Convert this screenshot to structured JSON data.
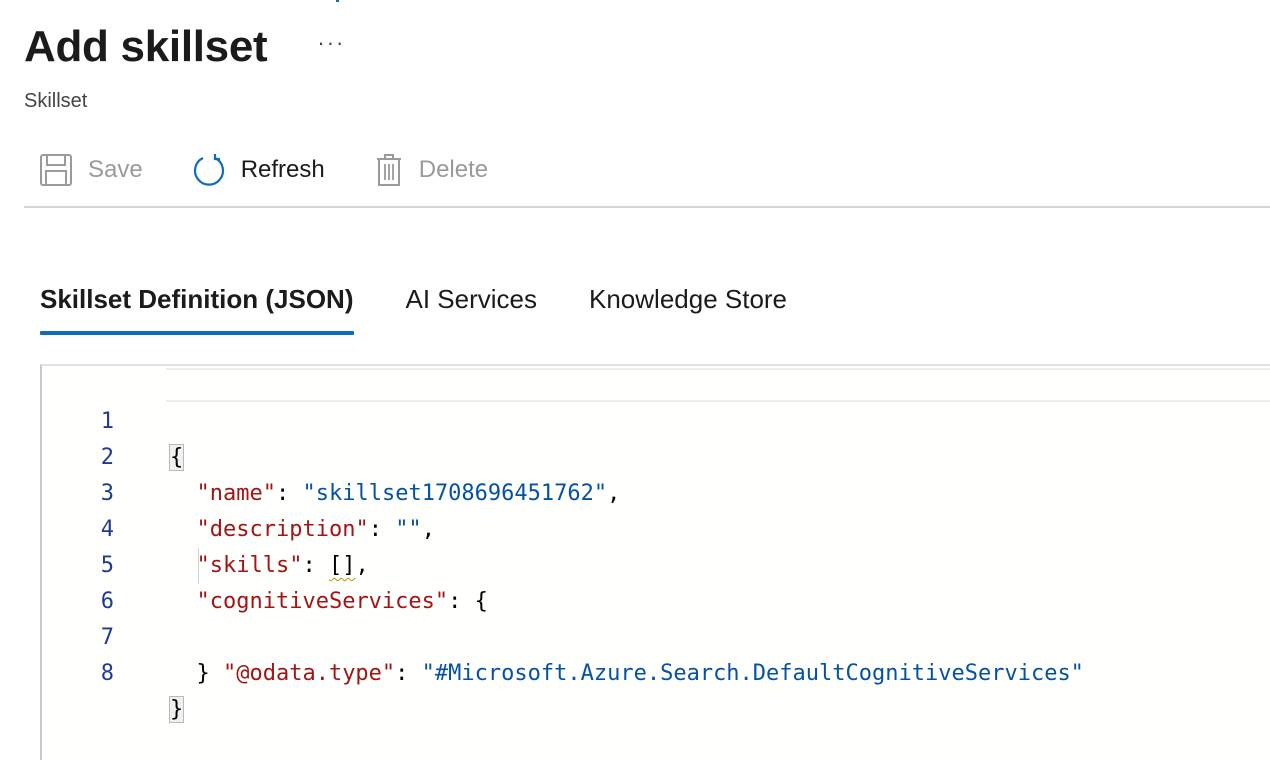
{
  "page": {
    "title": "Add skillset",
    "more_label": "···",
    "subtitle": "Skillset"
  },
  "toolbar": {
    "save_label": "Save",
    "refresh_label": "Refresh",
    "delete_label": "Delete"
  },
  "tabs": [
    {
      "label": "Skillset Definition (JSON)",
      "active": true
    },
    {
      "label": "AI Services",
      "active": false
    },
    {
      "label": "Knowledge Store",
      "active": false
    }
  ],
  "editor": {
    "line_numbers": [
      "1",
      "2",
      "3",
      "4",
      "5",
      "6",
      "7",
      "8"
    ],
    "tokens": {
      "open_brace": "{",
      "name_key": "\"name\"",
      "name_value": "\"skillset1708696451762\"",
      "description_key": "\"description\"",
      "description_value": "\"\"",
      "skills_key": "\"skills\"",
      "skills_value": "[]",
      "cog_key": "\"cognitiveServices\"",
      "odata_key": "\"@odata.type\"",
      "odata_value": "\"#Microsoft.Azure.Search.DefaultCognitiveServices\"",
      "inner_close": "}",
      "close_brace": "}",
      "colon": ": ",
      "comma": ",",
      "cog_open": ": {"
    }
  },
  "colors": {
    "accent": "#0f6cbd",
    "json_key": "#a31515",
    "json_string": "#0451a5",
    "line_number": "#1f3a93"
  }
}
